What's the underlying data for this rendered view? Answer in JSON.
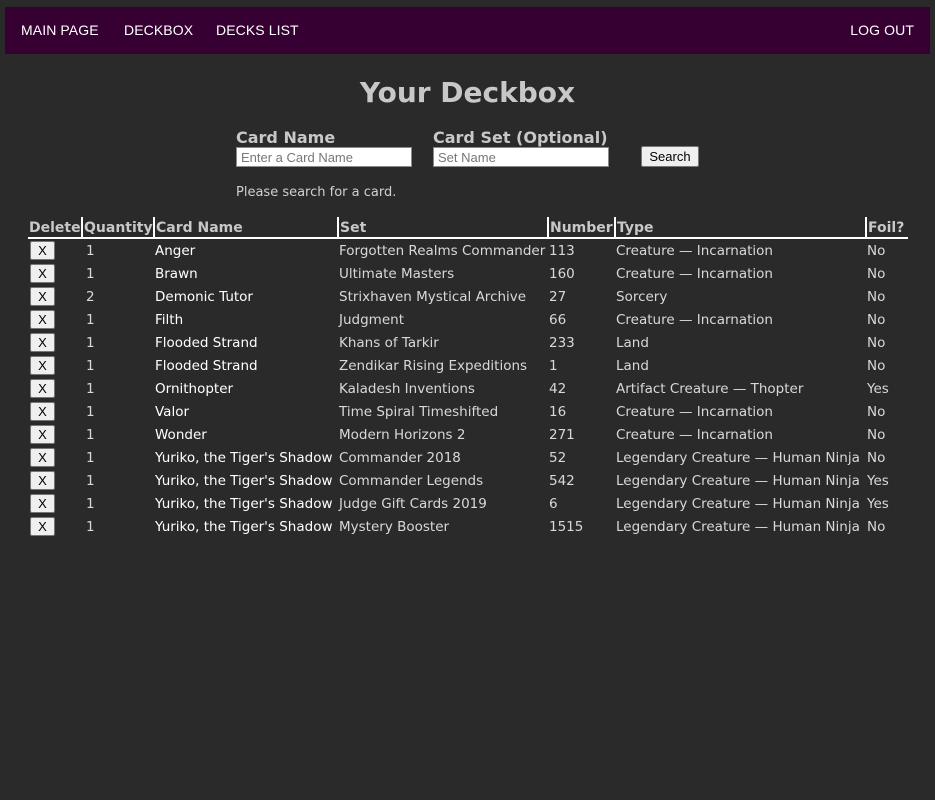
{
  "nav": {
    "main_page": "MAIN PAGE",
    "deckbox": "DECKBOX",
    "decks_list": "DECKS LIST",
    "log_out": "LOG OUT"
  },
  "page_title": "Your Deckbox",
  "search": {
    "card_name_label": "Card Name",
    "card_name_placeholder": "Enter a Card Name",
    "card_set_label": "Card Set (Optional)",
    "card_set_placeholder": "Set Name",
    "button_label": "Search",
    "hint": "Please search for a card."
  },
  "table": {
    "headers": [
      "Delete",
      "Quantity",
      "Card Name",
      "Set",
      "Number",
      "Type",
      "Foil?"
    ],
    "delete_label": "X",
    "rows": [
      {
        "quantity": "1",
        "name": "Anger",
        "set": "Forgotten Realms Commander",
        "number": "113",
        "type": "Creature — Incarnation",
        "foil": "No"
      },
      {
        "quantity": "1",
        "name": "Brawn",
        "set": "Ultimate Masters",
        "number": "160",
        "type": "Creature — Incarnation",
        "foil": "No"
      },
      {
        "quantity": "2",
        "name": "Demonic Tutor",
        "set": "Strixhaven Mystical Archive",
        "number": "27",
        "type": "Sorcery",
        "foil": "No"
      },
      {
        "quantity": "1",
        "name": "Filth",
        "set": "Judgment",
        "number": "66",
        "type": "Creature — Incarnation",
        "foil": "No"
      },
      {
        "quantity": "1",
        "name": "Flooded Strand",
        "set": "Khans of Tarkir",
        "number": "233",
        "type": "Land",
        "foil": "No"
      },
      {
        "quantity": "1",
        "name": "Flooded Strand",
        "set": "Zendikar Rising Expeditions",
        "number": "1",
        "type": "Land",
        "foil": "No"
      },
      {
        "quantity": "1",
        "name": "Ornithopter",
        "set": "Kaladesh Inventions",
        "number": "42",
        "type": "Artifact Creature — Thopter",
        "foil": "Yes"
      },
      {
        "quantity": "1",
        "name": "Valor",
        "set": "Time Spiral Timeshifted",
        "number": "16",
        "type": "Creature — Incarnation",
        "foil": "No"
      },
      {
        "quantity": "1",
        "name": "Wonder",
        "set": "Modern Horizons 2",
        "number": "271",
        "type": "Creature — Incarnation",
        "foil": "No"
      },
      {
        "quantity": "1",
        "name": "Yuriko, the Tiger's Shadow",
        "set": "Commander 2018",
        "number": "52",
        "type": "Legendary Creature — Human Ninja",
        "foil": "No"
      },
      {
        "quantity": "1",
        "name": "Yuriko, the Tiger's Shadow",
        "set": "Commander Legends",
        "number": "542",
        "type": "Legendary Creature — Human Ninja",
        "foil": "Yes"
      },
      {
        "quantity": "1",
        "name": "Yuriko, the Tiger's Shadow",
        "set": "Judge Gift Cards 2019",
        "number": "6",
        "type": "Legendary Creature — Human Ninja",
        "foil": "Yes"
      },
      {
        "quantity": "1",
        "name": "Yuriko, the Tiger's Shadow",
        "set": "Mystery Booster",
        "number": "1515",
        "type": "Legendary Creature — Human Ninja",
        "foil": "No"
      }
    ]
  },
  "colors": {
    "background": "#2a2a2a",
    "navbar": "#360033",
    "text": "#dcdcdc"
  }
}
